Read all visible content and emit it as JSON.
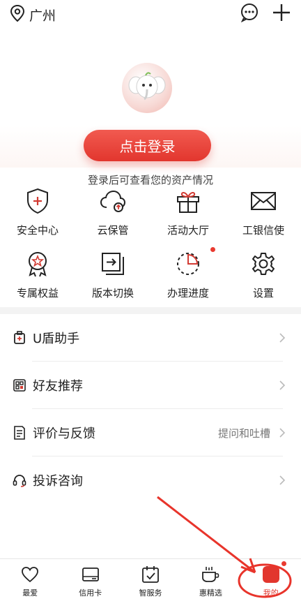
{
  "header": {
    "location": "广州",
    "location_icon": "location-pin-icon",
    "message_icon": "message-bubble-icon",
    "add_icon": "plus-icon"
  },
  "profile": {
    "avatar": "elephant-mascot",
    "login_button": "点击登录",
    "login_hint": "登录后可查看您的资产情况"
  },
  "grid": {
    "row1": [
      {
        "label": "安全中心",
        "icon": "shield-plus-icon"
      },
      {
        "label": "云保管",
        "icon": "cloud-upload-icon"
      },
      {
        "label": "活动大厅",
        "icon": "gift-icon"
      },
      {
        "label": "工银信使",
        "icon": "mail-icon"
      }
    ],
    "row2": [
      {
        "label": "专属权益",
        "icon": "badge-star-icon"
      },
      {
        "label": "版本切换",
        "icon": "switch-icon"
      },
      {
        "label": "办理进度",
        "icon": "progress-icon",
        "dot": true
      },
      {
        "label": "设置",
        "icon": "gear-icon"
      }
    ]
  },
  "list": [
    {
      "label": "U盾助手",
      "icon": "usb-key-icon",
      "extra": ""
    },
    {
      "label": "好友推荐",
      "icon": "qr-share-icon",
      "extra": ""
    },
    {
      "label": "评价与反馈",
      "icon": "feedback-icon",
      "extra": "提问和吐槽"
    },
    {
      "label": "投诉咨询",
      "icon": "headset-icon",
      "extra": ""
    }
  ],
  "tabbar": [
    {
      "label": "最爱",
      "icon": "heart-icon"
    },
    {
      "label": "信用卡",
      "icon": "credit-card-icon"
    },
    {
      "label": "智服务",
      "icon": "calendar-check-icon"
    },
    {
      "label": "惠精选",
      "icon": "cup-icon"
    },
    {
      "label": "我的",
      "icon": "mine-icon",
      "active": true
    }
  ],
  "colors": {
    "brand_red": "#e2362e",
    "text": "#222222",
    "muted": "#777777",
    "divider": "#f3f3f3"
  }
}
